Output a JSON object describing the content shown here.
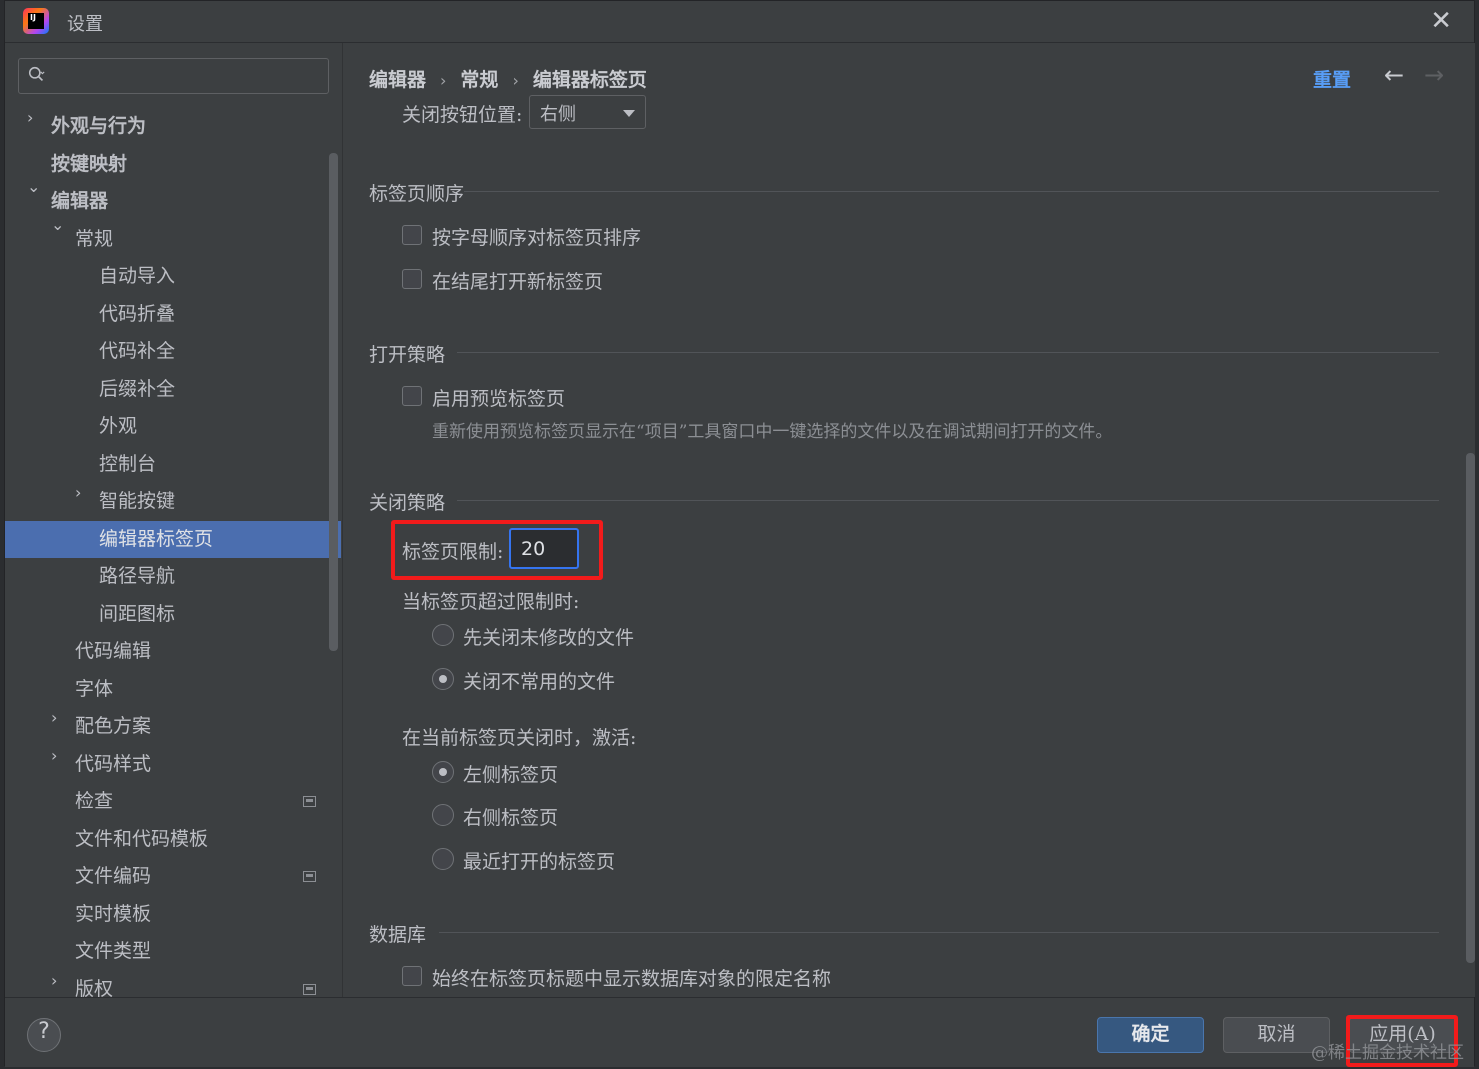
{
  "window": {
    "title": "设置",
    "logo_text": "IJ"
  },
  "search": {
    "placeholder": ""
  },
  "tree": [
    {
      "label": "外观与行为",
      "arrow": "›",
      "bold": true
    },
    {
      "label": "按键映射",
      "arrow": "",
      "bold": true
    },
    {
      "label": "编辑器",
      "arrow": "⌄",
      "bold": true
    },
    {
      "label": "常规",
      "arrow": "⌄"
    },
    {
      "label": "自动导入",
      "arrow": ""
    },
    {
      "label": "代码折叠",
      "arrow": ""
    },
    {
      "label": "代码补全",
      "arrow": ""
    },
    {
      "label": "后缀补全",
      "arrow": ""
    },
    {
      "label": "外观",
      "arrow": ""
    },
    {
      "label": "控制台",
      "arrow": ""
    },
    {
      "label": "智能按键",
      "arrow": "›"
    },
    {
      "label": "编辑器标签页",
      "arrow": "",
      "selected": true
    },
    {
      "label": "路径导航",
      "arrow": ""
    },
    {
      "label": "间距图标",
      "arrow": ""
    },
    {
      "label": "代码编辑",
      "arrow": ""
    },
    {
      "label": "字体",
      "arrow": ""
    },
    {
      "label": "配色方案",
      "arrow": "›"
    },
    {
      "label": "代码样式",
      "arrow": "›"
    },
    {
      "label": "检查",
      "arrow": "",
      "pin": true
    },
    {
      "label": "文件和代码模板",
      "arrow": ""
    },
    {
      "label": "文件编码",
      "arrow": "",
      "pin": true
    },
    {
      "label": "实时模板",
      "arrow": ""
    },
    {
      "label": "文件类型",
      "arrow": ""
    },
    {
      "label": "版权",
      "arrow": "›",
      "pin": true
    }
  ],
  "breadcrumb": [
    "编辑器",
    "常规",
    "编辑器标签页"
  ],
  "breadcrumb_sep": "›",
  "header": {
    "reset": "重置",
    "back": "←",
    "forward": "→"
  },
  "close_button": {
    "label": "关闭按钮位置:",
    "value": "右侧"
  },
  "sections": {
    "tab_order": {
      "title": "标签页顺序",
      "sort_alpha": "按字母顺序对标签页排序",
      "open_at_end": "在结尾打开新标签页"
    },
    "open_policy": {
      "title": "打开策略",
      "preview": "启用预览标签页",
      "preview_hint": "重新使用预览标签页显示在“项目”工具窗口中一键选择的文件以及在调试期间打开的文件。"
    },
    "close_policy": {
      "title": "关闭策略",
      "tab_limit_label": "标签页限制:",
      "tab_limit_value": "20",
      "when_exceed": "当标签页超过限制时:",
      "close_unmodified": "先关闭未修改的文件",
      "close_unused": "关闭不常用的文件",
      "on_close_activate": "在当前标签页关闭时，激活:",
      "left_tab": "左侧标签页",
      "right_tab": "右侧标签页",
      "recent_tab": "最近打开的标签页"
    },
    "database": {
      "title": "数据库",
      "show_qualified": "始终在标签页标题中显示数据库对象的限定名称"
    }
  },
  "footer": {
    "help": "?",
    "ok": "确定",
    "cancel": "取消",
    "apply": "应用(A)",
    "watermark": "@稀土掘金技术社区"
  },
  "colors": {
    "accent": "#4b6eaf",
    "link": "#589df6",
    "highlight": "#f21b1b"
  }
}
